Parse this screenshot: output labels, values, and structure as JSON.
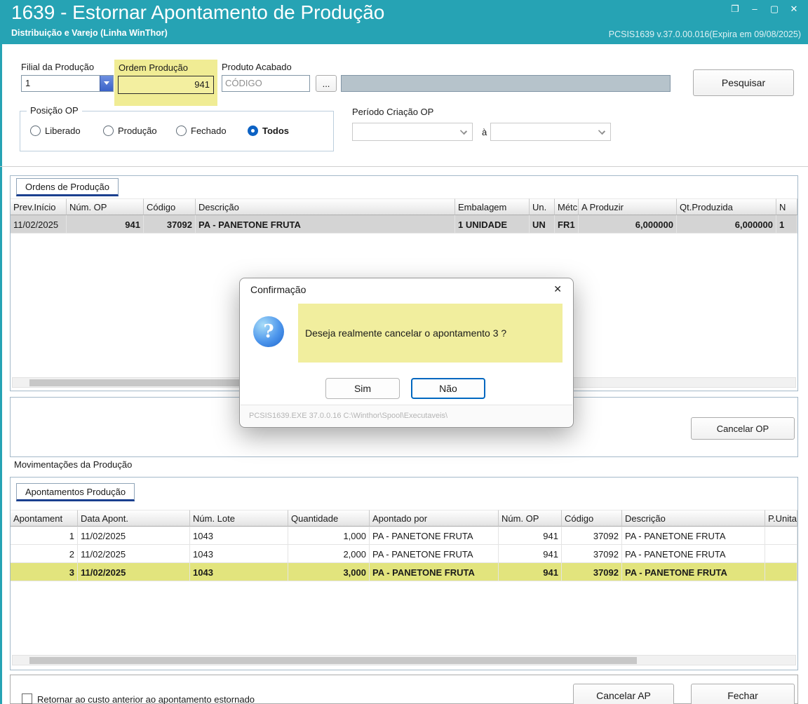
{
  "colors": {
    "titlebar": "#26A3B4",
    "highlight_yellow": "#F0EC94",
    "selected_row_green": "#E2E47D",
    "selected_row_gray": "#D4D4D4"
  },
  "icons": {
    "restore": "❐",
    "minimize": "–",
    "maximize": "▢",
    "close": "✕",
    "dialog_close": "✕",
    "question": "?",
    "ellipsis": "..."
  },
  "window": {
    "title": "1639 - Estornar Apontamento de Produção",
    "subtitle": "Distribuição e Varejo (Linha WinThor)",
    "version": "PCSIS1639  v.37.0.00.016(Expira em 09/08/2025)"
  },
  "filters": {
    "filial_label": "Filial da Produção",
    "filial_value": "1",
    "ordem_label": "Ordem Produção",
    "ordem_value": "941",
    "produto_label": "Produto Acabado",
    "produto_value": "CÓDIGO",
    "pesquisar_button": "Pesquisar",
    "posicao_label": "Posição OP",
    "posicao_options": [
      "Liberado",
      "Produção",
      "Fechado",
      "Todos"
    ],
    "posicao_selected": "Todos",
    "periodo_label": "Período Criação OP",
    "periodo_separator": "à"
  },
  "ordens": {
    "tab_label": "Ordens de Produção",
    "columns": [
      "Prev.Início",
      "Núm. OP",
      "Código",
      "Descrição",
      "Embalagem",
      "Un.",
      "Métc",
      "A Produzir",
      "Qt.Produzida",
      "N"
    ],
    "row": [
      "11/02/2025",
      "941",
      "37092",
      "PA - PANETONE FRUTA",
      "1 UNIDADE",
      "UN",
      "FR1",
      "6,000000",
      "6,000000",
      "1"
    ]
  },
  "actions": {
    "cancelar_op": "Cancelar OP",
    "cancelar_ap": "Cancelar AP",
    "fechar": "Fechar"
  },
  "dialog": {
    "title": "Confirmação",
    "message": "Deseja realmente cancelar o apontamento 3 ?",
    "yes_button": "Sim",
    "no_button": "Não",
    "status_text": "PCSIS1639.EXE 37.0.0.16 C:\\Winthor\\Spool\\Executaveis\\"
  },
  "movimentacoes": {
    "group_label": "Movimentações da Produção",
    "tab_label": "Apontamentos Produção",
    "columns": [
      "Apontament",
      "Data Apont.",
      "Núm. Lote",
      "Quantidade",
      "Apontado por",
      "Núm. OP",
      "Código",
      "Descrição",
      "P.Unita"
    ],
    "rows": [
      [
        "1",
        "11/02/2025",
        "1043",
        "1,000",
        "PA - PANETONE FRUTA",
        "941",
        "37092",
        "PA - PANETONE FRUTA",
        ""
      ],
      [
        "2",
        "11/02/2025",
        "1043",
        "2,000",
        "PA - PANETONE FRUTA",
        "941",
        "37092",
        "PA - PANETONE FRUTA",
        ""
      ],
      [
        "3",
        "11/02/2025",
        "1043",
        "3,000",
        "PA - PANETONE FRUTA",
        "941",
        "37092",
        "PA - PANETONE FRUTA",
        ""
      ]
    ]
  },
  "footer": {
    "checkbox_label": "Retornar ao custo anterior ao apontamento estornado"
  }
}
